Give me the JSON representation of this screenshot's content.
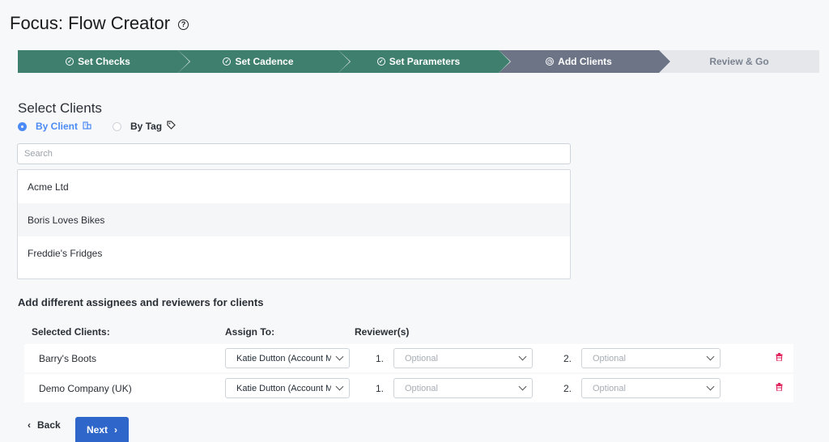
{
  "page": {
    "title": "Focus: Flow Creator"
  },
  "stepper": [
    {
      "label": "Set Checks",
      "state": "done"
    },
    {
      "label": "Set Cadence",
      "state": "done"
    },
    {
      "label": "Set Parameters",
      "state": "done"
    },
    {
      "label": "Add Clients",
      "state": "active"
    },
    {
      "label": "Review & Go",
      "state": "todo"
    }
  ],
  "select_clients": {
    "title": "Select Clients",
    "by_client_label": "By Client",
    "by_tag_label": "By Tag",
    "selected_mode": "By Client",
    "search_placeholder": "Search",
    "items": [
      "Acme Ltd",
      "Boris Loves Bikes",
      "Freddie's Fridges"
    ]
  },
  "assignees": {
    "title": "Add different assignees and reviewers for clients",
    "headers": {
      "clients": "Selected Clients:",
      "assign": "Assign To:",
      "reviewers": "Reviewer(s)"
    },
    "reviewer_num_1": "1.",
    "reviewer_num_2": "2.",
    "rows": [
      {
        "client": "Barry's Boots",
        "assign_to": "Katie Dutton (Account Manager)",
        "reviewer1": "Optional",
        "reviewer2": "Optional"
      },
      {
        "client": "Demo Company (UK)",
        "assign_to": "Katie Dutton (Account Manager)",
        "reviewer1": "Optional",
        "reviewer2": "Optional"
      }
    ]
  },
  "footer": {
    "back_label": "Back",
    "next_label": "Next"
  },
  "colors": {
    "step_done": "#3f7f6e",
    "step_active": "#6c7486",
    "step_todo": "#e5e7eb",
    "primary": "#2f66c9",
    "accent": "#4c8bf5",
    "danger": "#e0245e"
  }
}
